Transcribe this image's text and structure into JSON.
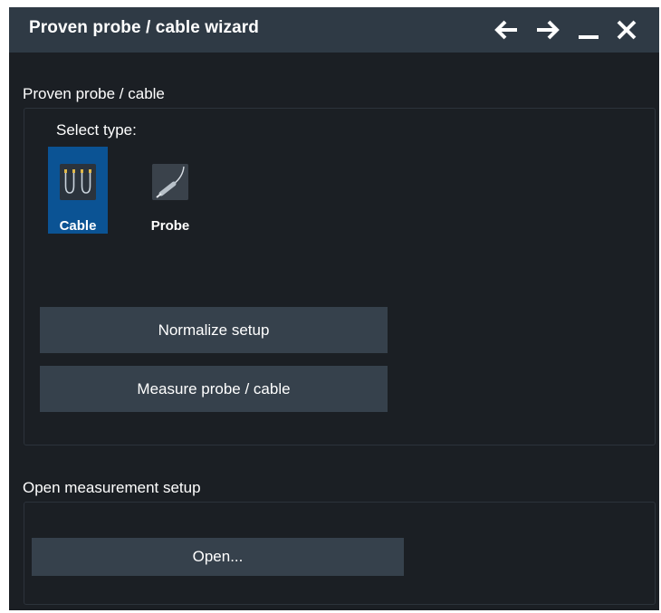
{
  "window": {
    "title": "Proven probe / cable wizard",
    "icons": [
      "arrow-left-icon",
      "arrow-right-icon",
      "minimize-icon",
      "close-icon"
    ]
  },
  "proven_section": {
    "label": "Proven probe / cable",
    "select_type_label": "Select type:",
    "types": [
      {
        "label": "Cable",
        "icon": "cable-icon",
        "selected": true
      },
      {
        "label": "Probe",
        "icon": "probe-icon",
        "selected": false
      }
    ],
    "normalize_button": "Normalize setup",
    "measure_button": "Measure probe / cable"
  },
  "open_section": {
    "label": "Open measurement setup",
    "open_button": "Open..."
  },
  "colors": {
    "background": "#1b1f24",
    "titlebar": "#2f3a45",
    "button": "#36414c",
    "selected": "#0b5394",
    "text": "#ffffff"
  }
}
